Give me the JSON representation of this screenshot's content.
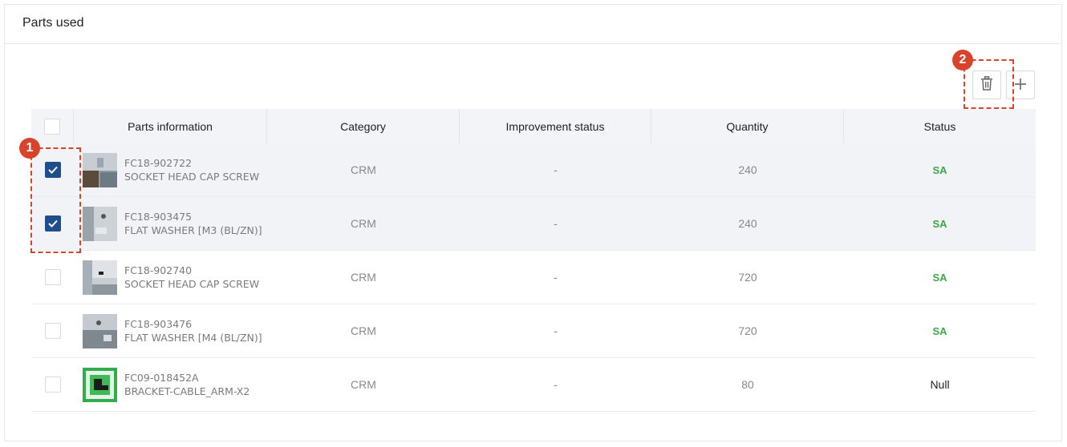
{
  "panel": {
    "title": "Parts used"
  },
  "toolbar": {
    "delete_icon": "trash-icon",
    "add_icon": "plus-icon",
    "add_glyph": "+"
  },
  "annotations": [
    {
      "label": "1",
      "target": "row-checkboxes"
    },
    {
      "label": "2",
      "target": "delete-button"
    }
  ],
  "table": {
    "columns": [
      "Parts information",
      "Category",
      "Improvement status",
      "Quantity",
      "Status"
    ],
    "rows": [
      {
        "checked": true,
        "code": "FC18-902722",
        "name": "SOCKET HEAD CAP SCREW",
        "category": "CRM",
        "improvement": "-",
        "quantity": "240",
        "status": "SA"
      },
      {
        "checked": true,
        "code": "FC18-903475",
        "name": "FLAT WASHER [M3 (BL/ZN)]",
        "category": "CRM",
        "improvement": "-",
        "quantity": "240",
        "status": "SA"
      },
      {
        "checked": false,
        "code": "FC18-902740",
        "name": "SOCKET HEAD CAP SCREW",
        "category": "CRM",
        "improvement": "-",
        "quantity": "720",
        "status": "SA"
      },
      {
        "checked": false,
        "code": "FC18-903476",
        "name": "FLAT WASHER [M4 (BL/ZN)]",
        "category": "CRM",
        "improvement": "-",
        "quantity": "720",
        "status": "SA"
      },
      {
        "checked": false,
        "code": "FC09-018452A",
        "name": "BRACKET-CABLE_ARM-X2",
        "category": "CRM",
        "improvement": "-",
        "quantity": "80",
        "status": "Null"
      }
    ]
  },
  "colors": {
    "accent": "#1f4e8c",
    "status_ok": "#3aa845",
    "annotation": "#d9422b"
  }
}
